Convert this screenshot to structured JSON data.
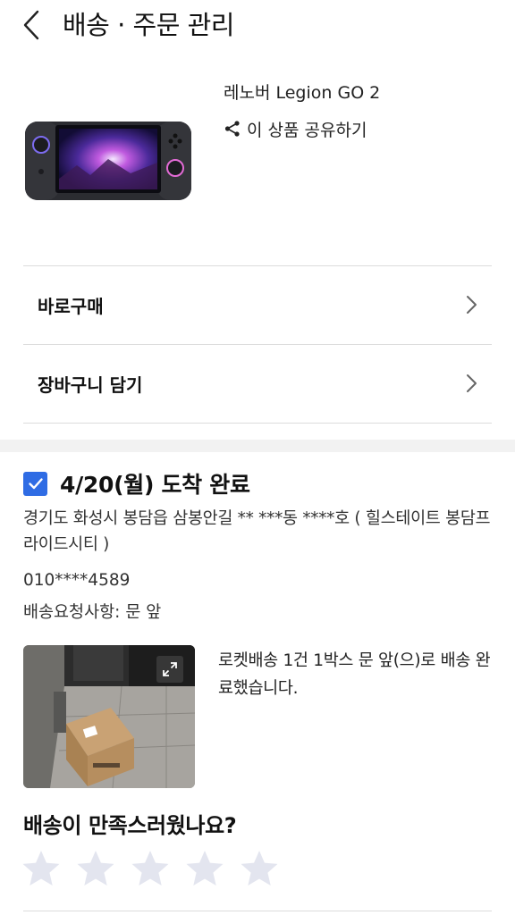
{
  "header": {
    "title": "배송 · 주문 관리",
    "back_icon": "chevron-left-icon"
  },
  "product": {
    "name": "레노버 Legion GO 2",
    "share_label": "이 상품 공유하기",
    "share_icon": "share-icon",
    "image": "handheld-console-image"
  },
  "actions": [
    {
      "label": "바로구매",
      "icon": "chevron-right-icon"
    },
    {
      "label": "장바구니 담기",
      "icon": "chevron-right-icon"
    }
  ],
  "delivery": {
    "checked": true,
    "status": "4/20(월) 도착 완료",
    "address": "경기도 화성시 봉담읍 삼봉안길 ** ***동 ****호 ( 힐스테이트 봉담프라이드시티 )",
    "phone": "010****4589",
    "request_label": "배송요청사항:",
    "request_value": "문 앞",
    "photo": "delivered-package-photo",
    "message": "로켓배송 1건 1박스 문 앞(으)로 배송 완료했습니다."
  },
  "rating": {
    "question": "배송이 만족스러웠나요?",
    "max_stars": 5,
    "selected": 0
  },
  "colors": {
    "accent": "#2f6ce4",
    "divider": "#dcdcdc",
    "star_empty": "#e3e5ef",
    "section_gap": "#f2f2f2"
  }
}
